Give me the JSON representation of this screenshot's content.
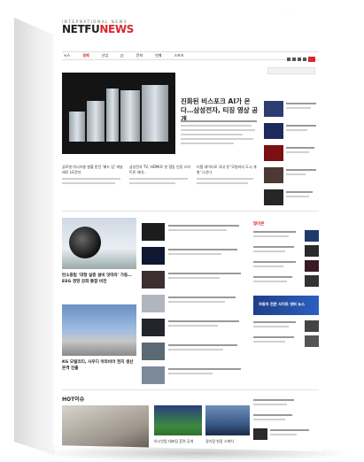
{
  "brand": {
    "kicker": "INTERNATIONAL NEWS",
    "name_part1": "NETFU",
    "name_part2": "NEWS",
    "accent": "#d7282f"
  },
  "nav": {
    "items": [
      "뉴스",
      "경제",
      "산업",
      "IT",
      "문화",
      "연예",
      "스포츠"
    ],
    "active_index": 1
  },
  "hero": {
    "title": "진화된 비스포크 AI가 온다…삼성전자, 티징 영상 공개",
    "image_alt": "삼성전자 비스포크 가전 라인업"
  },
  "sub_headlines": [
    "글로벌 마니아층 쌀풀 받던 '배드 업' 피날레로 LG전자",
    "삼성전자 TV, HDMI로 첫 협동 인증 스마트폰 세대…",
    "티맵 데이터로 국내 첫 '모빌리티 도시 개발' 나선다"
  ],
  "mid": {
    "caption1": "탄소중립 '대형 실증 설비 잇따라' 가동…ESG 경영 강화 통합 비전",
    "caption2": "KG 모빌리티, 사우디 아라비아 현지 생산 본격 진출"
  },
  "right": {
    "section_label": "많이본",
    "banner_text": "자동차 전문 사이트 넷퍼 뉴스"
  },
  "hot": {
    "label": "HOT이슈",
    "captions": [
      "아시안컵 대표팀 훈련 공개",
      "경기장 현장 스케치"
    ]
  },
  "colors": {
    "hero_bg": "#141414",
    "banner": "#2d5fbf"
  }
}
